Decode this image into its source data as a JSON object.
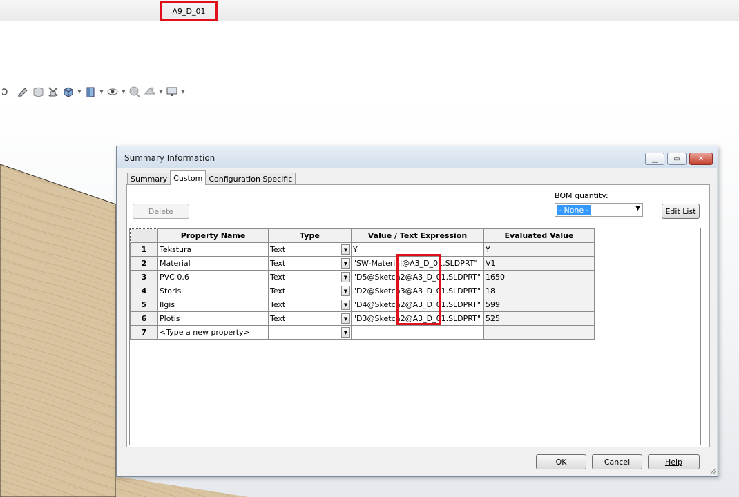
{
  "app": {
    "document_title": "A9_D_01"
  },
  "toolbar": {
    "icons": [
      "zoom-area-icon",
      "section-view-icon",
      "previous-view-icon",
      "dynamic-annotation-icon",
      "view-orientation-icon",
      "display-style-icon",
      "hide-show-icon",
      "edit-appearance-icon",
      "apply-scene-icon",
      "view-settings-icon"
    ]
  },
  "dialog": {
    "title": "Summary Information",
    "tabs": [
      {
        "label": "Summary"
      },
      {
        "label": "Custom"
      },
      {
        "label": "Configuration Specific"
      }
    ],
    "delete_label": "Delete",
    "bom_label": "BOM quantity:",
    "bom_value": "- None -",
    "edit_list_label": "Edit List",
    "columns": [
      "Property Name",
      "Type",
      "Value / Text Expression",
      "Evaluated Value"
    ],
    "rows": [
      {
        "num": "1",
        "name": "Tekstura",
        "type": "Text",
        "value": "Y",
        "evaluated": "Y"
      },
      {
        "num": "2",
        "name": "Material",
        "type": "Text",
        "value": "\"SW-Material@A3_D_01.SLDPRT\"",
        "evaluated": "V1"
      },
      {
        "num": "3",
        "name": "PVC 0.6",
        "type": "Text",
        "value": "\"D5@Sketch2@A3_D_01.SLDPRT\"",
        "evaluated": "1650"
      },
      {
        "num": "4",
        "name": "Storis",
        "type": "Text",
        "value": "\"D2@Sketch3@A3_D_01.SLDPRT\"",
        "evaluated": "18"
      },
      {
        "num": "5",
        "name": "Ilgis",
        "type": "Text",
        "value": "\"D4@Sketch2@A3_D_01.SLDPRT\"",
        "evaluated": "599"
      },
      {
        "num": "6",
        "name": "Plotis",
        "type": "Text",
        "value": "\"D3@Sketch2@A3_D_01.SLDPRT\"",
        "evaluated": "525"
      },
      {
        "num": "7",
        "name": "<Type a new property>",
        "type": "",
        "value": "",
        "evaluated": ""
      }
    ],
    "ok_label": "OK",
    "cancel_label": "Cancel",
    "help_label": "Help"
  },
  "colors": {
    "highlight": "#e0101a",
    "selection": "#3399ff",
    "wood": "#d8c3a0"
  }
}
